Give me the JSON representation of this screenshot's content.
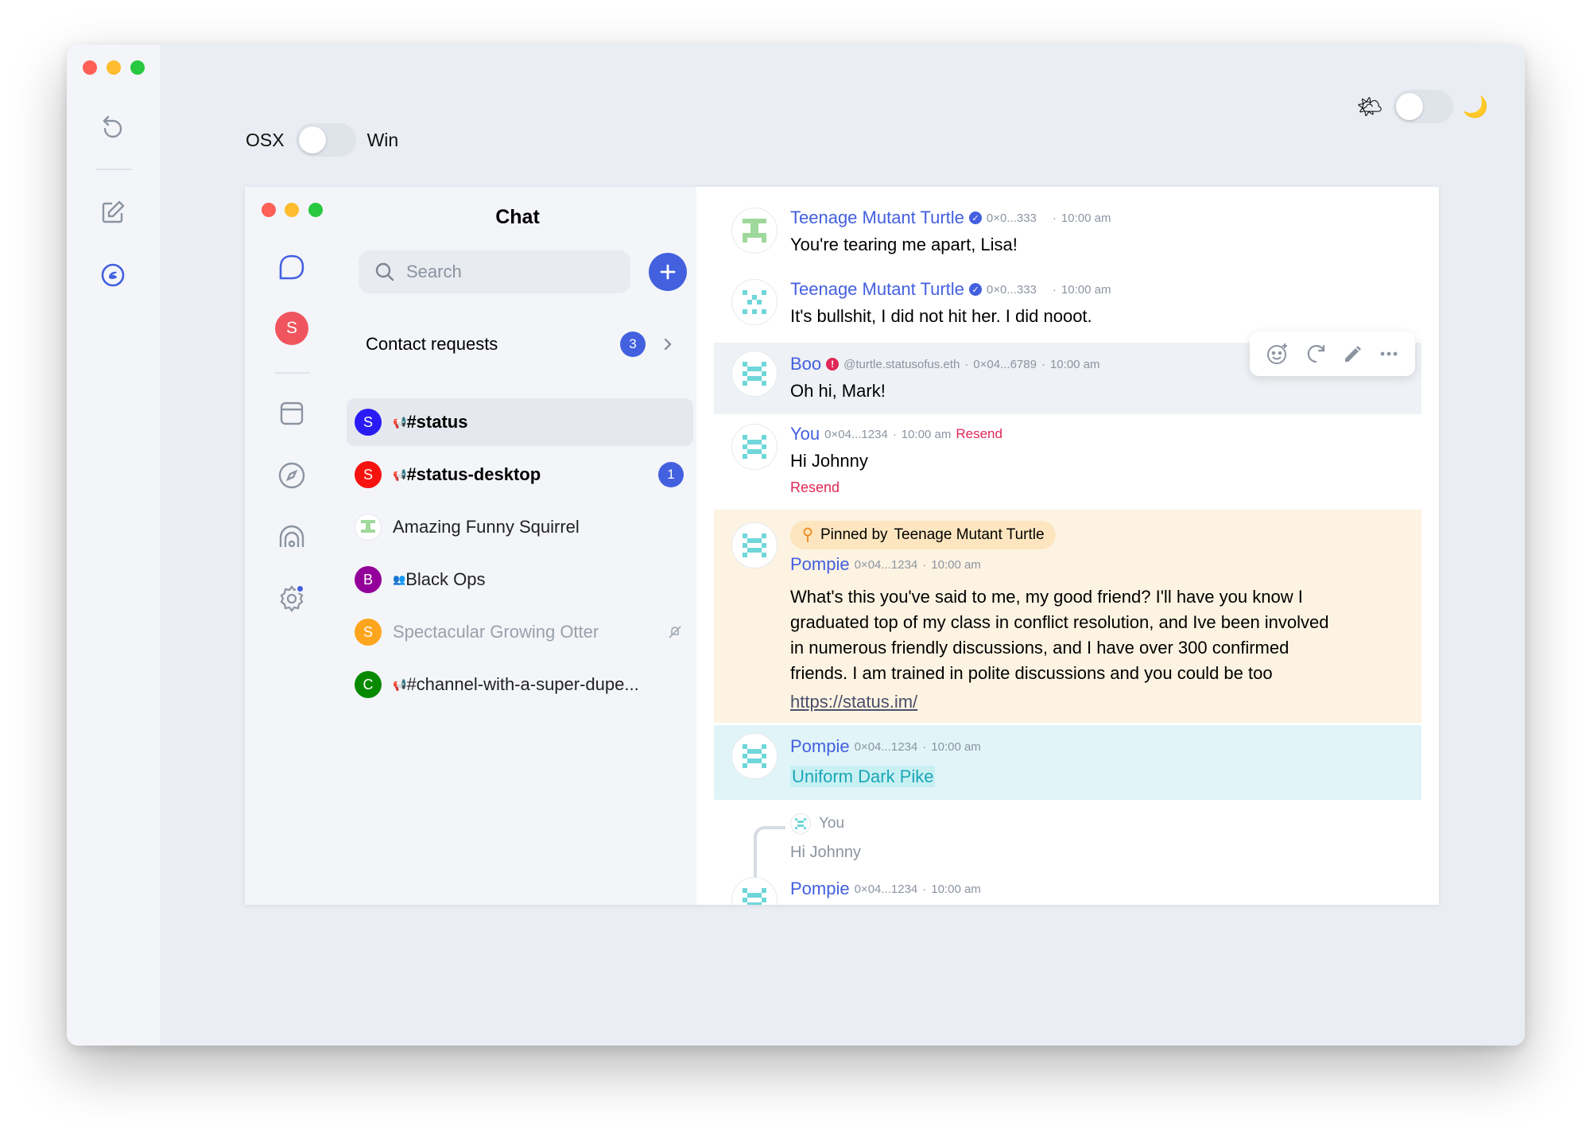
{
  "colors": {
    "accent": "#4360df",
    "danger": "#e02757",
    "pinned_bg": "#fdf3e2",
    "mention_bg": "#e1f5f8",
    "hover_bg": "#eef1f5"
  },
  "outer": {
    "rail_icons": [
      "undo-icon",
      "edit-icon",
      "status-logo-icon"
    ]
  },
  "platform_toggle": {
    "left_label": "OSX",
    "right_label": "Win",
    "state": "off"
  },
  "theme_toggle": {
    "light_icon": "🌤",
    "dark_icon": "🌙",
    "state": "off"
  },
  "inner_nav": {
    "avatar_initial": "S",
    "avatar_color": "#f0555e",
    "icons": [
      "chat-bubble-icon",
      "communities-icon",
      "wallet-icon",
      "browser-icon",
      "node-icon",
      "settings-icon"
    ]
  },
  "sidebar": {
    "title": "Chat",
    "search_placeholder": "Search",
    "contact_requests": {
      "label": "Contact requests",
      "count": "3"
    },
    "channels": [
      {
        "initial": "S",
        "color": "#2a1bf4",
        "prefix": "📢",
        "name": "#status",
        "bold": true,
        "active": true,
        "badge": "",
        "muted": false
      },
      {
        "initial": "S",
        "color": "#f5120f",
        "prefix": "📢",
        "name": "#status-desktop",
        "bold": true,
        "active": false,
        "badge": "1",
        "muted": false
      },
      {
        "initial": "",
        "color": "#ffffff",
        "prefix": "",
        "name": "Amazing Funny Squirrel",
        "bold": false,
        "active": false,
        "badge": "",
        "muted": false
      },
      {
        "initial": "B",
        "color": "#930099",
        "prefix": "👥",
        "name": "Black Ops",
        "bold": false,
        "active": false,
        "badge": "",
        "muted": false
      },
      {
        "initial": "S",
        "color": "#ffa51d",
        "prefix": "",
        "name": "Spectacular Growing Otter",
        "bold": false,
        "active": false,
        "badge": "",
        "muted": true
      },
      {
        "initial": "C",
        "color": "#078a00",
        "prefix": "📢",
        "name": "#channel-with-a-super-dupe...",
        "bold": false,
        "active": false,
        "badge": "",
        "muted": false
      }
    ]
  },
  "messages": [
    {
      "name": "Teenage Mutant Turtle",
      "verified": true,
      "address": "0×0...333",
      "time": "10:00 am",
      "text": "You're tearing me apart, Lisa!"
    },
    {
      "name": "Teenage Mutant Turtle",
      "verified": true,
      "address": "0×0...333",
      "time": "10:00 am",
      "text": "It's bullshit, I did not hit her. I did nooot."
    },
    {
      "name": "Boo",
      "warning": true,
      "ens": "@turtle.statusofus.eth",
      "address": "0×04...6789",
      "time": "10:00 am",
      "text": "Oh hi, Mark!"
    },
    {
      "name": "You",
      "address": "0×04...1234",
      "time": "10:00 am",
      "resend_inline": "Resend",
      "text": "Hi Johnny",
      "resend_below": "Resend"
    },
    {
      "pinned_label": "Pinned by",
      "pinned_by": "Teenage Mutant Turtle",
      "name": "Pompie",
      "address": "0×04...1234",
      "time": "10:00 am",
      "lines": [
        "What's this you've said to me, my good friend? I'll have you know I",
        "graduated top of my class in conflict resolution, and Ive been involved",
        "in numerous friendly discussions, and I have over 300 confirmed",
        "friends. I am trained in polite discussions and you could be too"
      ],
      "link": "https://status.im/"
    },
    {
      "name": "Pompie",
      "address": "0×04...1234",
      "time": "10:00 am",
      "mention": "Uniform Dark Pike"
    },
    {
      "reply_name": "You",
      "reply_text": "Hi Johnny",
      "name": "Pompie",
      "address": "0×04...1234",
      "time": "10:00 am"
    }
  ],
  "hover_toolbar": [
    "add-reaction-icon",
    "reply-icon",
    "edit-icon",
    "more-icon"
  ]
}
